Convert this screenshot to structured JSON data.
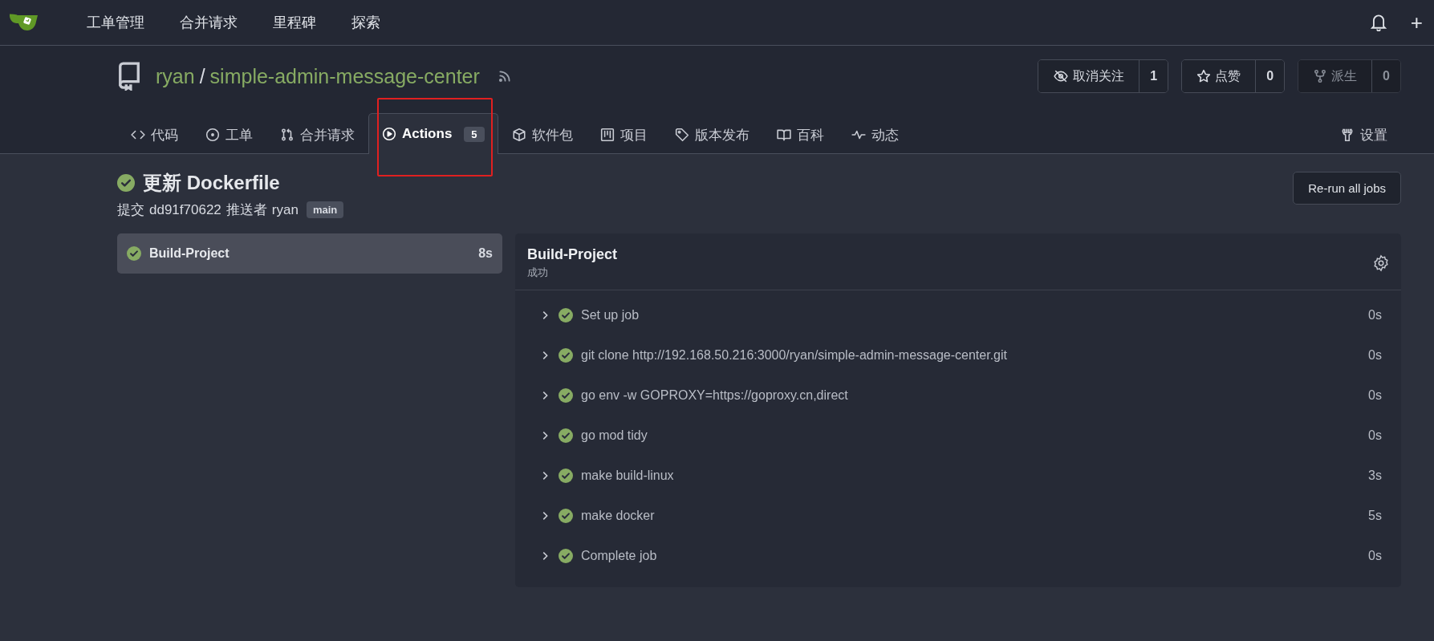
{
  "top_nav": {
    "items": [
      "工单管理",
      "合并请求",
      "里程碑",
      "探索"
    ],
    "plus": "+"
  },
  "repo": {
    "owner": "ryan",
    "separator": "/",
    "name": "simple-admin-message-center",
    "buttons": [
      {
        "kind": "watch",
        "label": "取消关注",
        "count": "1",
        "disabled": false
      },
      {
        "kind": "star",
        "label": "点赞",
        "count": "0",
        "disabled": false
      },
      {
        "kind": "fork",
        "label": "派生",
        "count": "0",
        "disabled": true
      }
    ]
  },
  "tabs": [
    {
      "kind": "code",
      "label": "代码",
      "selected": false
    },
    {
      "kind": "issues",
      "label": "工单",
      "selected": false
    },
    {
      "kind": "pulls",
      "label": "合并请求",
      "selected": false
    },
    {
      "kind": "actions",
      "label": "Actions",
      "badge": "5",
      "selected": true
    },
    {
      "kind": "packages",
      "label": "软件包",
      "selected": false
    },
    {
      "kind": "projects",
      "label": "项目",
      "selected": false
    },
    {
      "kind": "releases",
      "label": "版本发布",
      "selected": false
    },
    {
      "kind": "wiki",
      "label": "百科",
      "selected": false
    },
    {
      "kind": "activity",
      "label": "动态",
      "selected": false
    }
  ],
  "settings_tab": {
    "label": "设置",
    "selected": false
  },
  "run": {
    "kind": "success",
    "title": "更新 Dockerfile",
    "commit_label": "提交",
    "commit": "dd91f70622",
    "pusher_label": "推送者",
    "pusher": "ryan",
    "branch": "main",
    "rerun_button": "Re-run all jobs"
  },
  "jobs": [
    {
      "name": "Build-Project",
      "kind": "success",
      "duration": "8s",
      "selected": true
    }
  ],
  "job_detail": {
    "title": "Build-Project",
    "status_text": "成功",
    "steps": [
      {
        "name": "Set up job",
        "kind": "success",
        "duration": "0s",
        "expanded": false
      },
      {
        "name": "git clone http://192.168.50.216:3000/ryan/simple-admin-message-center.git",
        "kind": "success",
        "duration": "0s",
        "expanded": false
      },
      {
        "name": "go env -w GOPROXY=https://goproxy.cn,direct",
        "kind": "success",
        "duration": "0s",
        "expanded": false
      },
      {
        "name": "go mod tidy",
        "kind": "success",
        "duration": "0s",
        "expanded": false
      },
      {
        "name": "make build-linux",
        "kind": "success",
        "duration": "3s",
        "expanded": false
      },
      {
        "name": "make docker",
        "kind": "success",
        "duration": "5s",
        "expanded": false
      },
      {
        "name": "Complete job",
        "kind": "success",
        "duration": "0s",
        "expanded": false
      }
    ]
  }
}
